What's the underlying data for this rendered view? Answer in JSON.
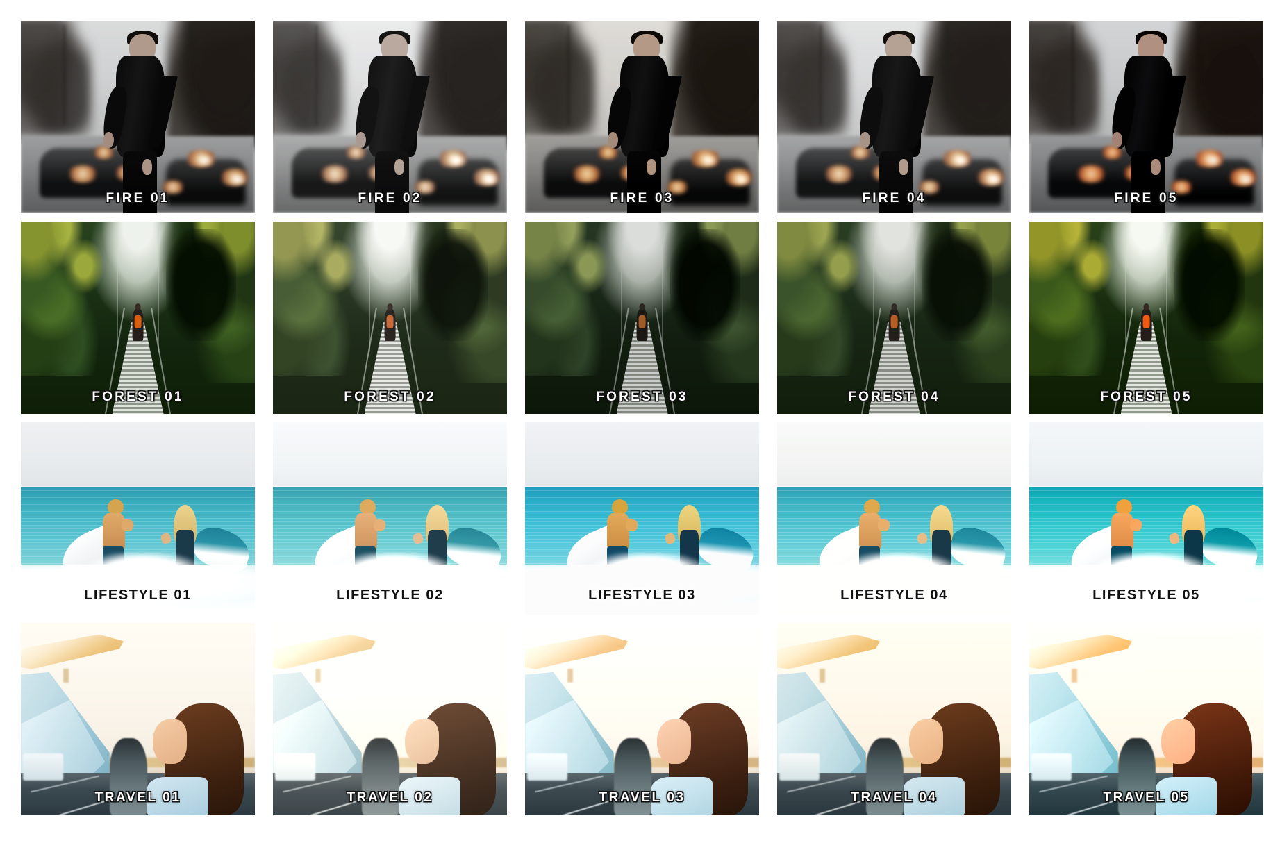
{
  "page": {
    "title": "Lightroom Preset Pack Preview Grid",
    "background_color": "#ffffff",
    "columns": 5,
    "rows": 4,
    "tile_count": 20
  },
  "rows": [
    {
      "id": "fire",
      "group_name": "FIRE",
      "scene_description": "Man in black bomber jacket on a city street with blurred cars and tail lights",
      "label_style": "light",
      "tiles": [
        {
          "label": "FIRE 01",
          "variant": "v1"
        },
        {
          "label": "FIRE 02",
          "variant": "v2"
        },
        {
          "label": "FIRE 03",
          "variant": "v3"
        },
        {
          "label": "FIRE 04",
          "variant": "v4"
        },
        {
          "label": "FIRE 05",
          "variant": "v5"
        }
      ]
    },
    {
      "id": "forest",
      "group_name": "FOREST",
      "scene_description": "Hiker with orange backpack crossing a jungle suspension bridge",
      "label_style": "light",
      "tiles": [
        {
          "label": "FOREST 01",
          "variant": "v1"
        },
        {
          "label": "FOREST 02",
          "variant": "v2"
        },
        {
          "label": "FOREST 03",
          "variant": "v3"
        },
        {
          "label": "FOREST 04",
          "variant": "v4"
        },
        {
          "label": "FOREST 05",
          "variant": "v5"
        }
      ]
    },
    {
      "id": "lifestyle",
      "group_name": "LIFESTYLE",
      "scene_description": "Two surfers running into turquoise ocean surf carrying surfboards",
      "label_style": "dark",
      "tiles": [
        {
          "label": "LIFESTYLE 01",
          "variant": "v1"
        },
        {
          "label": "LIFESTYLE 02",
          "variant": "v2"
        },
        {
          "label": "LIFESTYLE 03",
          "variant": "v3"
        },
        {
          "label": "LIFESTYLE 04",
          "variant": "v4"
        },
        {
          "label": "LIFESTYLE 05",
          "variant": "v5"
        }
      ]
    },
    {
      "id": "travel",
      "group_name": "TRAVEL",
      "scene_description": "Woman with long brown hair boarding an airplane on the tarmac at sunset",
      "label_style": "light",
      "tiles": [
        {
          "label": "TRAVEL 01",
          "variant": "v1"
        },
        {
          "label": "TRAVEL 02",
          "variant": "v2"
        },
        {
          "label": "TRAVEL 03",
          "variant": "v3"
        },
        {
          "label": "TRAVEL 04",
          "variant": "v4"
        },
        {
          "label": "TRAVEL 05",
          "variant": "v5"
        }
      ]
    }
  ]
}
